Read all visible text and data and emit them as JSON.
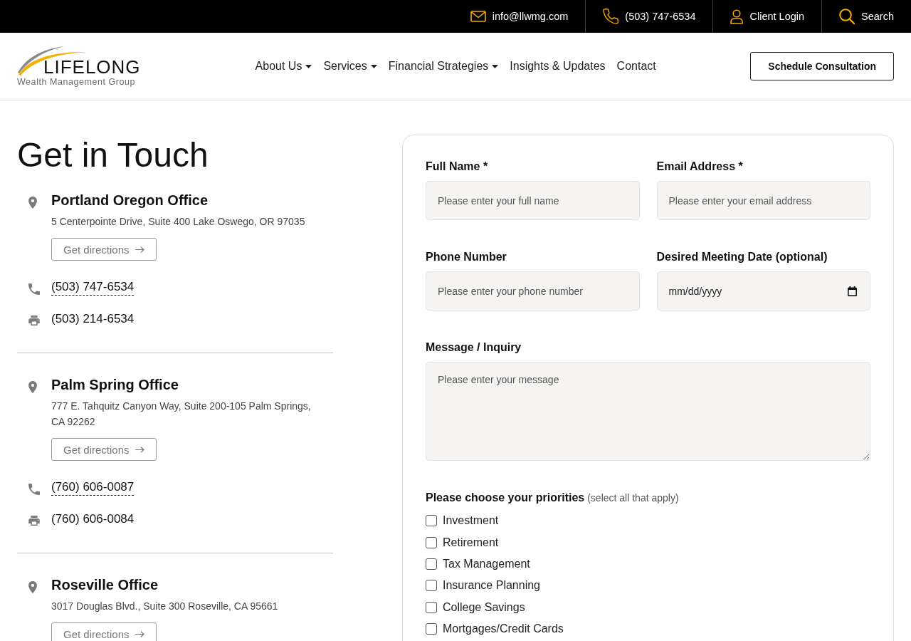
{
  "top_bar": {
    "links": [
      {
        "kind": "email",
        "label": "info@llwmg.com"
      },
      {
        "kind": "phone",
        "label": "(503) 747-6534"
      },
      {
        "kind": "login",
        "label": "Client Login"
      },
      {
        "kind": "search",
        "label": "Search"
      }
    ]
  },
  "header": {
    "logo": {
      "wordmark": "LIFELONG",
      "tagline": "Wealth Management Group"
    },
    "nav": [
      {
        "label": "About Us",
        "dropdown": true
      },
      {
        "label": "Services",
        "dropdown": true
      },
      {
        "label": "Financial Strategies",
        "dropdown": true
      },
      {
        "label": "Insights & Updates",
        "dropdown": false
      },
      {
        "label": "Contact",
        "dropdown": false
      }
    ],
    "cta": "Schedule Consultation"
  },
  "contact": {
    "title": "Get in Touch",
    "offices": [
      {
        "name": "Portland Oregon Office",
        "address": "5 Centerpointe Drive, Suite 400 Lake Oswego, OR 97035",
        "directions": "Get directions",
        "phone": "(503) 747-6534",
        "fax": "(503) 214-6534"
      },
      {
        "name": "Palm Spring Office",
        "address": "777 E. Tahquitz Canyon Way, Suite 200-105 Palm Springs, CA 92262",
        "directions": "Get directions",
        "phone": "(760) 606-0087",
        "fax": "(760) 606-0084"
      },
      {
        "name": "Roseville Office",
        "address": "3017 Douglas Blvd., Suite 300 Roseville, CA 95661",
        "directions": "Get directions"
      }
    ]
  },
  "form": {
    "fields": [
      {
        "kind": "text",
        "label": "Full Name *",
        "placeholder": "Please enter your full name"
      },
      {
        "kind": "text",
        "label": "Email Address *",
        "placeholder": "Please enter your email address"
      },
      {
        "kind": "text",
        "label": "Phone Number",
        "placeholder": "Please enter your phone number"
      },
      {
        "kind": "date",
        "label": "Desired Meeting Date (optional)",
        "placeholder": "mm/dd/yyyy"
      },
      {
        "kind": "textarea",
        "label": "Message / Inquiry",
        "placeholder": "Please enter your message"
      }
    ],
    "priorities": {
      "title": "Please choose your priorities",
      "hint": "(select all that apply)",
      "options": [
        {
          "label": "Investment",
          "checked": false
        },
        {
          "label": "Retirement",
          "checked": false
        },
        {
          "label": "Tax Management",
          "checked": false
        },
        {
          "label": "Insurance Planning",
          "checked": false
        },
        {
          "label": "College Savings",
          "checked": false
        },
        {
          "label": "Mortgages/Credit Cards",
          "checked": false
        }
      ]
    }
  }
}
